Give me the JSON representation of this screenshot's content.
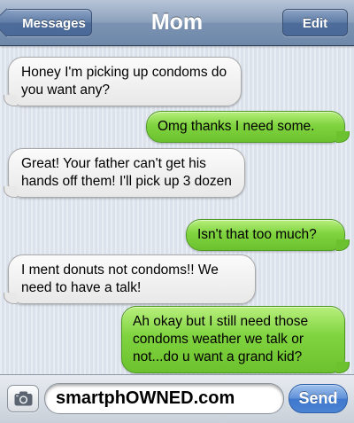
{
  "nav": {
    "title": "Mom",
    "back_label": "Messages",
    "edit_label": "Edit"
  },
  "messages": [
    {
      "direction": "received",
      "text": "Honey I'm picking up condoms do you want any?"
    },
    {
      "direction": "sent",
      "text": "Omg thanks I need some."
    },
    {
      "direction": "received",
      "text": "Great! Your father can't get his hands off them! I'll pick up 3 dozen"
    },
    {
      "direction": "sent",
      "text": "Isn't that too much?"
    },
    {
      "direction": "received",
      "text": "I ment donuts not condoms!! We need to have a talk!"
    },
    {
      "direction": "sent",
      "text": "Ah okay but I still need those condoms weather we talk or not...do u want a grand kid?"
    }
  ],
  "composer": {
    "input_value": "smartphOWNED.com",
    "send_label": "Send",
    "camera_icon": "camera-icon"
  },
  "colors": {
    "sent_bubble": "#7fd33f",
    "received_bubble": "#eeeeee",
    "nav_bar": "#7b93b2",
    "send_button": "#4b84d4"
  }
}
